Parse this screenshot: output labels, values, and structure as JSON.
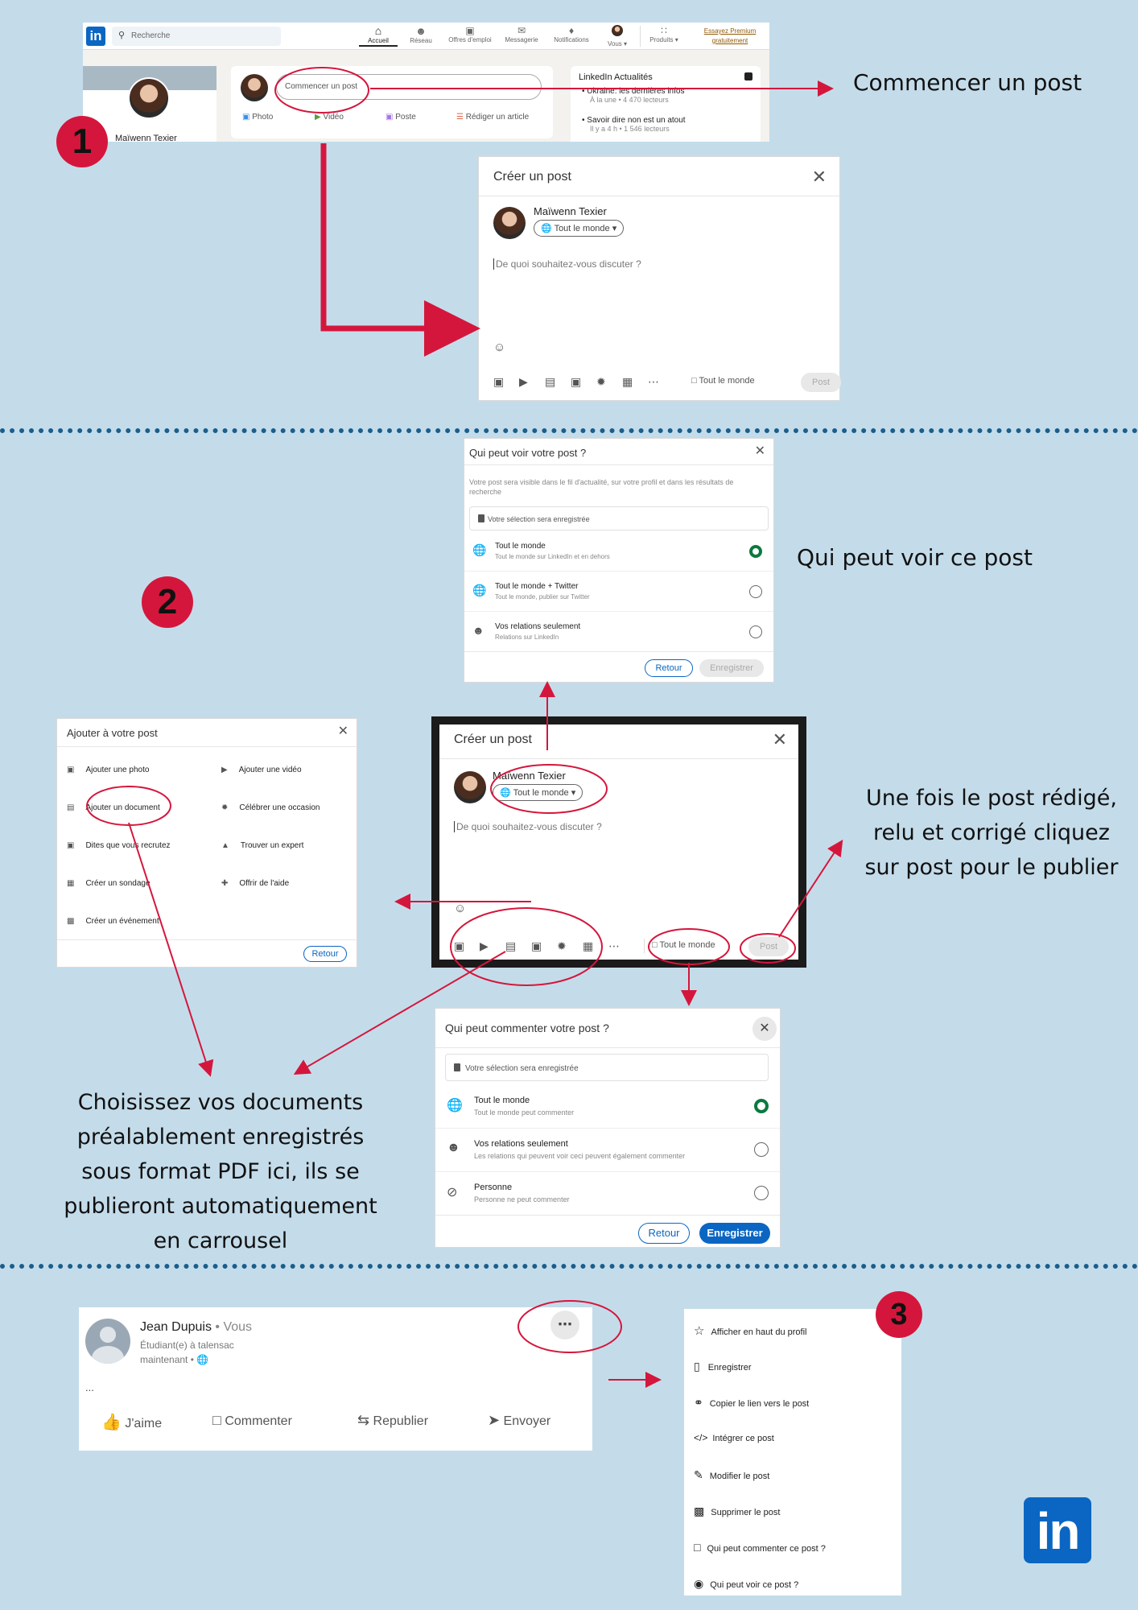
{
  "section1": {
    "navbar": {
      "logo": "in",
      "search_placeholder": "Recherche",
      "items": [
        "Accueil",
        "Réseau",
        "Offres d'emploi",
        "Messagerie",
        "Notifications",
        "Vous ▾",
        "Produits ▾"
      ],
      "premium_line1": "Essayez Premium",
      "premium_line2": "gratuitement"
    },
    "profile_name": "Maïwenn Texier",
    "start_post_placeholder": "Commencer un post",
    "actions": [
      "Photo",
      "Vidéo",
      "Poste",
      "Rédiger un article"
    ],
    "news_title": "LinkedIn Actualités",
    "news_items": [
      {
        "title": "Ukraine: les dernières infos",
        "meta": "À la une • 4 470 lecteurs"
      },
      {
        "title": "Savoir dire non est un atout",
        "meta": "Il y a 4 h • 1 546 lecteurs"
      }
    ],
    "caption": "Commencer un post",
    "create_dialog": {
      "title": "Créer un post",
      "author": "Maïwenn Texier",
      "audience": "Tout le monde",
      "placeholder": "De quoi souhaitez-vous discuter ?",
      "comment_audience": "Tout le monde",
      "post_label": "Post"
    },
    "badge": "1"
  },
  "section2": {
    "badge": "2",
    "visibility_dialog": {
      "title": "Qui peut voir votre post ?",
      "description": "Votre post sera visible dans le fil d'actualité, sur votre profil et dans les résultats de recherche",
      "notice": "Votre sélection sera enregistrée",
      "options": [
        {
          "title": "Tout le monde",
          "sub": "Tout le monde sur LinkedIn et en dehors"
        },
        {
          "title": "Tout le monde + Twitter",
          "sub": "Tout le monde, publier sur Twitter"
        },
        {
          "title": "Vos relations seulement",
          "sub": "Relations sur LinkedIn"
        }
      ],
      "back": "Retour",
      "save": "Enregistrer"
    },
    "visibility_caption": "Qui peut voir ce post",
    "add_dialog": {
      "title": "Ajouter à votre post",
      "left": [
        "Ajouter une photo",
        "Ajouter un document",
        "Dites que vous recrutez",
        "Créer un sondage",
        "Créer un événement"
      ],
      "right": [
        "Ajouter une vidéo",
        "Célébrer une occasion",
        "Trouver un expert",
        "Offrir de l'aide"
      ],
      "back": "Retour"
    },
    "create_dialog": {
      "title": "Créer un post",
      "author": "Maïwenn Texier",
      "audience": "Tout le monde",
      "placeholder": "De quoi souhaitez-vous discuter ?",
      "comment_audience": "Tout le monde",
      "post_label": "Post"
    },
    "publish_caption": "Une fois le post rédigé, relu et corrigé cliquez sur post pour le publier",
    "comment_dialog": {
      "title": "Qui peut commenter votre post ?",
      "notice": "Votre sélection sera enregistrée",
      "options": [
        {
          "title": "Tout le monde",
          "sub": "Tout le monde peut commenter"
        },
        {
          "title": "Vos relations seulement",
          "sub": "Les relations qui peuvent voir ceci peuvent également commenter"
        },
        {
          "title": "Personne",
          "sub": "Personne ne peut commenter"
        }
      ],
      "back": "Retour",
      "save": "Enregistrer"
    },
    "documents_caption": "Choisissez vos documents préalablement enregistrés sous format PDF ici, ils se publieront automatiquement en carrousel"
  },
  "section3": {
    "badge": "3",
    "post": {
      "name": "Jean Dupuis",
      "you": " • Vous",
      "headline": "Étudiant(e) à talensac",
      "time": "maintenant • ",
      "body": "...",
      "actions": [
        "J'aime",
        "Commenter",
        "Republier",
        "Envoyer"
      ]
    },
    "menu": [
      "Afficher en haut du profil",
      "Enregistrer",
      "Copier le lien vers le post",
      "Intégrer ce post",
      "Modifier le post",
      "Supprimer le post",
      "Qui peut commenter ce post ?",
      "Qui peut voir ce post ?"
    ],
    "logo": "in"
  },
  "colors": {
    "accent_red": "#d5163c",
    "linkedin_blue": "#0a66c2",
    "background": "#c4dcea",
    "green_radio": "#0a7a3f"
  }
}
